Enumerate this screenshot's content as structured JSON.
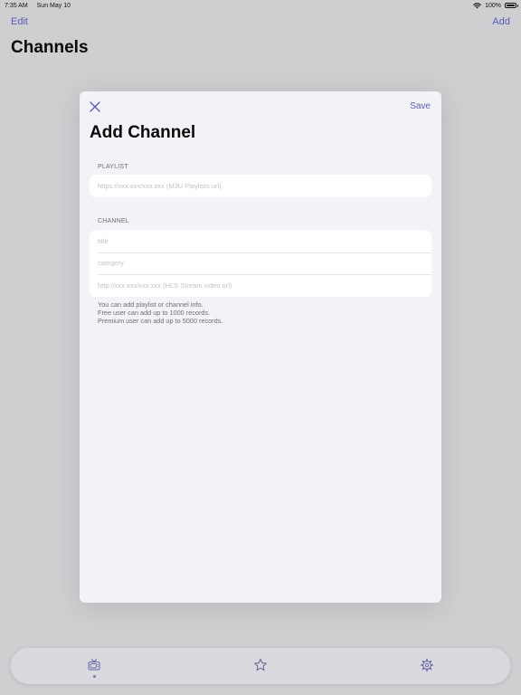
{
  "status_bar": {
    "time": "7:35 AM",
    "date": "Sun May 10",
    "battery": "100%",
    "wifi_icon": "wifi-icon",
    "battery_icon": "battery-icon"
  },
  "nav": {
    "edit_label": "Edit",
    "add_label": "Add",
    "title": "Channels"
  },
  "modal": {
    "close_icon": "close-icon",
    "save_label": "Save",
    "title": "Add Channel",
    "playlist_section": {
      "label": "PLAYLIST",
      "url_placeholder": "https://xxx.xxx/xxx.xxx (M3U Playlists url)",
      "url_value": ""
    },
    "channel_section": {
      "label": "CHANNEL",
      "title_placeholder": "title",
      "category_placeholder": "category",
      "url_placeholder": "http://xxx.xxx/xxx.xxx (HLS Stream video url)"
    },
    "notes": [
      "You can add playlist or channel info.",
      "Free user can add up to 1000 records.",
      "Premium user can add up to 5000 records."
    ]
  },
  "tab_bar": {
    "tabs": [
      {
        "icon": "tv-icon",
        "selected": true
      },
      {
        "icon": "star-icon",
        "selected": false
      },
      {
        "icon": "gear-icon",
        "selected": false
      }
    ]
  },
  "colors": {
    "accent": "#5a5ab8",
    "background": "#cfcfd2",
    "modal_background": "#f2f2f7"
  }
}
